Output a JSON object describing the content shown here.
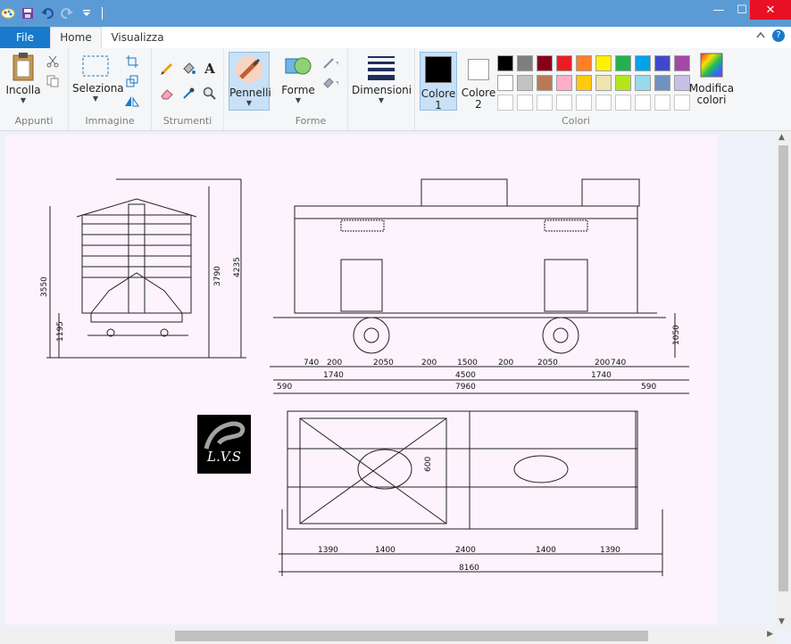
{
  "window": {
    "quick_access": [
      "paint-app-icon",
      "save-icon",
      "undo-icon",
      "redo-icon",
      "customize-icon"
    ],
    "controls": {
      "minimize": "—",
      "maximize": "☐",
      "close": "✕"
    }
  },
  "tabs": {
    "file": "File",
    "home": "Home",
    "view": "Visualizza"
  },
  "ribbon": {
    "clipboard": {
      "paste": "Incolla",
      "group": "Appunti"
    },
    "image": {
      "select": "Seleziona",
      "group": "Immagine"
    },
    "tools": {
      "group": "Strumenti"
    },
    "brushes": {
      "label": "Pennelli"
    },
    "shapes": {
      "label": "Forme",
      "group": "Forme"
    },
    "size": {
      "label": "Dimensioni"
    },
    "colors": {
      "color1": "Colore 1",
      "color2": "Colore 2",
      "edit": "Modifica colori",
      "group": "Colori",
      "color1_value": "#000000",
      "color2_value": "#ffffff",
      "palette_row1": [
        "#000000",
        "#7f7f7f",
        "#880015",
        "#ed1c24",
        "#ff7f27",
        "#fff200",
        "#22b14c",
        "#00a2e8",
        "#3f48cc",
        "#a349a4"
      ],
      "palette_row2": [
        "#ffffff",
        "#c3c3c3",
        "#b97a57",
        "#ffaec9",
        "#ffc90e",
        "#efe4b0",
        "#b5e61d",
        "#99d9ea",
        "#7092be",
        "#c8bfe7"
      ]
    }
  },
  "drawing": {
    "logo_text": "L.V.S",
    "end_dims": {
      "h1": "3550",
      "h2": "3790",
      "h3": "4235",
      "h4": "1195"
    },
    "side_dims": {
      "right_h": "1050",
      "row1": [
        "740",
        "200",
        "2050",
        "200",
        "1500",
        "200",
        "2050",
        "200",
        "740"
      ],
      "row2": [
        "1740",
        "4500",
        "1740"
      ],
      "row3": [
        "590",
        "7960",
        "590"
      ]
    },
    "plan_dims": {
      "inner": "600",
      "row1": [
        "1390",
        "1400",
        "2400",
        "1400",
        "1390"
      ],
      "total": "8160"
    }
  }
}
